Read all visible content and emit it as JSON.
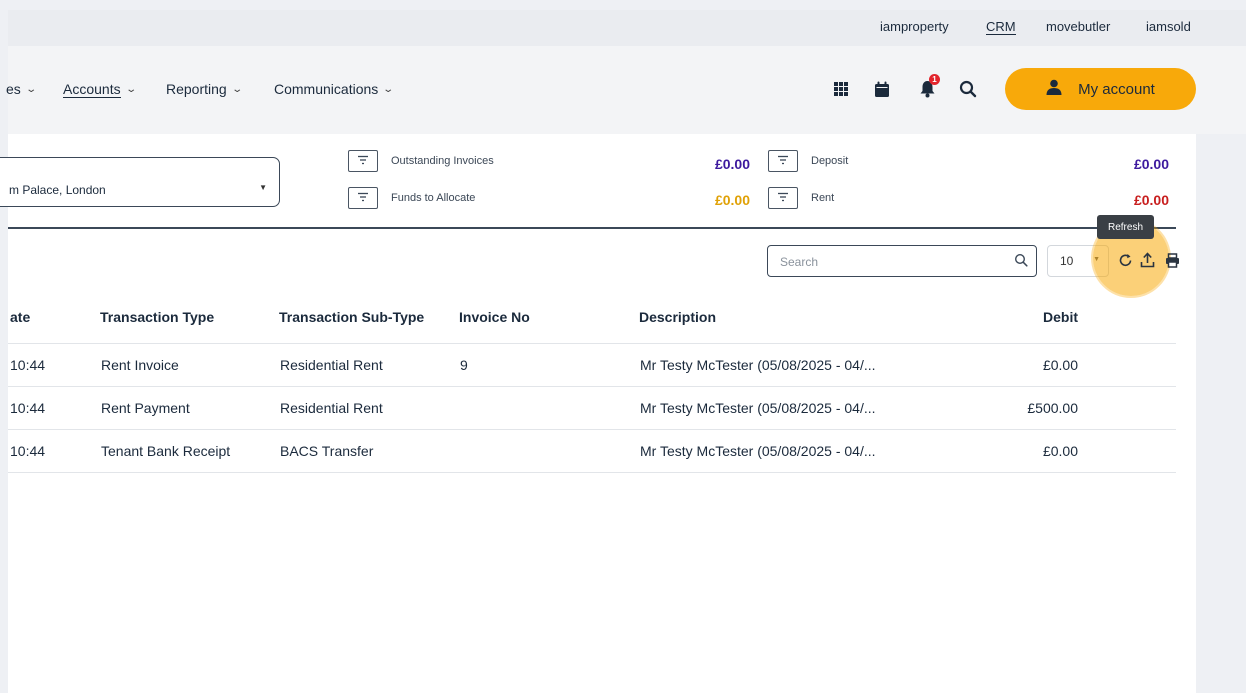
{
  "utility_links": [
    {
      "label": "iamproperty",
      "active": false
    },
    {
      "label": "CRM",
      "active": true
    },
    {
      "label": "movebutler",
      "active": false
    },
    {
      "label": "iamsold",
      "active": false
    }
  ],
  "nav": {
    "items": [
      {
        "label": "es"
      },
      {
        "label": "Accounts"
      },
      {
        "label": "Reporting"
      },
      {
        "label": "Communications"
      }
    ],
    "notification_count": "1",
    "my_account_label": "My account"
  },
  "filters": {
    "property_value": "m Palace, London"
  },
  "summary": [
    {
      "label": "Outstanding Invoices",
      "value": "£0.00",
      "color": "#3d1a9e"
    },
    {
      "label": "Funds to Allocate",
      "value": "£0.00",
      "color": "#e0a106"
    },
    {
      "label": "Deposit",
      "value": "£0.00",
      "color": "#3d1a9e"
    },
    {
      "label": "Rent",
      "value": "£0.00",
      "color": "#c81e1e"
    }
  ],
  "toolbar": {
    "search_placeholder": "Search",
    "page_size": "10",
    "refresh_tooltip": "Refresh"
  },
  "table": {
    "columns": [
      "ate",
      "Transaction Type",
      "Transaction Sub-Type",
      "Invoice No",
      "Description",
      "Debit"
    ],
    "rows": [
      {
        "date": "10:44",
        "type": "Rent Invoice",
        "subtype": "Residential Rent",
        "invoice": "9",
        "description": "Mr Testy McTester (05/08/2025 - 04/...",
        "debit": "£0.00"
      },
      {
        "date": "10:44",
        "type": "Rent Payment",
        "subtype": "Residential Rent",
        "invoice": "",
        "description": "Mr Testy McTester (05/08/2025 - 04/...",
        "debit": "£500.00"
      },
      {
        "date": "10:44",
        "type": "Tenant Bank Receipt",
        "subtype": "BACS Transfer",
        "invoice": "",
        "description": "Mr Testy McTester (05/08/2025 - 04/...",
        "debit": "£0.00"
      }
    ]
  },
  "colors": {
    "accent": "#f8a90a",
    "text": "#1b2a3c"
  }
}
